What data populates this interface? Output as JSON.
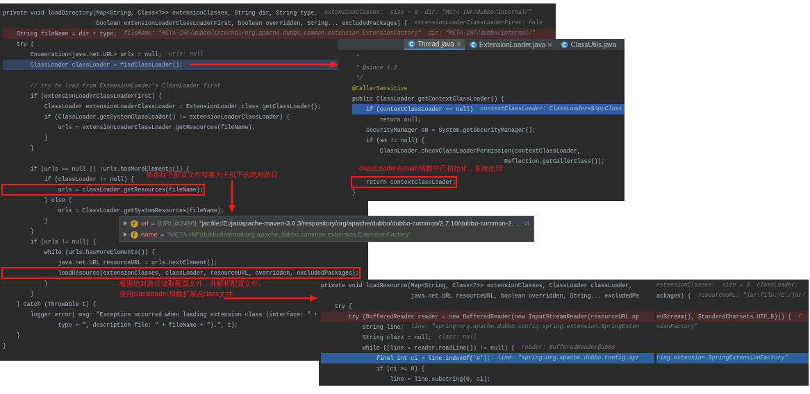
{
  "main_editor": {
    "lines": [
      {
        "code": "private void loadDirectory(Map<String, Class<?>> extensionClasses, String dir, String type,",
        "hint": "extensionClasses:  size = 0  dir: \"META-INF/dubbo/internal/\"",
        "kind": "normal"
      },
      {
        "code": "                           boolean extensionLoaderClassLoaderFirst, boolean overridden, String... excludedPackages) {",
        "hint": "extensionLoaderClassLoaderFirst: fals",
        "kind": "normal"
      },
      {
        "code": "    String fileName = dir + type;",
        "hint": "fileName: \"META-INF/dubbo/internal/org.apache.dubbo.common.extension.ExtensionFactory\"  dir: \"META-INF/dubbo/internal/\"",
        "kind": "error"
      },
      {
        "code": "    try {",
        "kind": "normal"
      },
      {
        "code": "        Enumeration<java.net.URL> urls = null;",
        "hint": "urls: null",
        "kind": "normal"
      },
      {
        "code": "        ClassLoader classLoader = findClassLoader();",
        "kind": "selected"
      },
      {
        "kind": "normal"
      },
      {
        "code": "        // try to load from ExtensionLoader's ClassLoader first",
        "kind": "comment"
      },
      {
        "code": "        if (extensionLoaderClassLoaderFirst) {",
        "kind": "normal"
      },
      {
        "code": "            ClassLoader extensionLoaderClassLoader = ExtensionLoader.class.getClassLoader();",
        "kind": "normal"
      },
      {
        "code": "            if (ClassLoader.getSystemClassLoader() != extensionLoaderClassLoader) {",
        "kind": "normal"
      },
      {
        "code": "                urls = extensionLoaderClassLoader.getResources(fileName);",
        "kind": "normal"
      },
      {
        "code": "            }",
        "kind": "normal"
      },
      {
        "code": "        }",
        "kind": "normal"
      },
      {
        "kind": "normal"
      },
      {
        "code": "        if (urls == null || !urls.hasMoreElements()) {",
        "kind": "normal"
      },
      {
        "code": "            if (classLoader != null) {",
        "kind": "normal"
      },
      {
        "code": "                urls = classLoader.getResources(fileName);",
        "kind": "normal",
        "boxed": true
      },
      {
        "code": "            } else {",
        "kind": "normal"
      },
      {
        "code": "                urls = ClassLoader.getSystemResources(fileName);",
        "kind": "normal"
      },
      {
        "code": "            }",
        "kind": "normal"
      },
      {
        "code": "        }",
        "kind": "normal"
      },
      {
        "code": "        if (urls != null) {",
        "kind": "normal"
      },
      {
        "code": "            while (urls.hasMoreElements()) {",
        "kind": "normal"
      },
      {
        "code": "                java.net.URL resourceURL = urls.nextElement();",
        "kind": "normal"
      },
      {
        "code": "                loadResource(extensionClasses, classLoader, resourceURL, overridden, excludedPackages);",
        "kind": "normal",
        "boxed": true
      },
      {
        "code": "            }",
        "kind": "normal"
      },
      {
        "code": "        }",
        "kind": "normal"
      },
      {
        "code": "    } catch (Throwable t) {",
        "kind": "normal"
      },
      {
        "code": "        logger.error( msg: \"Exception occurred when loading extension class (interface: \" +",
        "kind": "normal"
      },
      {
        "code": "                type + \", description file: \" + fileName + \").\", t);",
        "kind": "normal"
      },
      {
        "code": "    }",
        "kind": "normal"
      },
      {
        "code": "}",
        "kind": "normal"
      }
    ],
    "annotations": [
      "类路径下配置文件转换为主机下的绝对路径",
      "根据绝对路径读取配置文件，并解析配置文件。",
      "使用classloader加载扩展点class文件"
    ]
  },
  "debug_popup": {
    "rows": [
      {
        "name": "url",
        "separator": "=",
        "ref": "{URL@2490}",
        "value": "\"jar:file:/E:/jar/apache-maven-3.6.3/respository/org/apache/dubbo/dubbo-common/2.7.10/dubbo-common-2.",
        "more": "... Vi",
        "kind": "object"
      },
      {
        "name": "name",
        "separator": "=",
        "value": "\"META-INF/dubbo/internal/org.apache.dubbo.common.extension.ExtensionFactory\"",
        "kind": "string"
      }
    ]
  },
  "thread_editor": {
    "tabs": [
      {
        "label": "Thread.java",
        "selected": true,
        "closable": true
      },
      {
        "label": "ExtensionLoader.java",
        "selected": false,
        "closable": true
      },
      {
        "label": "ClassUtils.java",
        "selected": false
      }
    ],
    "lines": [
      {
        "code": " *",
        "kind": "comment"
      },
      {
        "code": " * @since 1.2",
        "kind": "comment"
      },
      {
        "code": " */",
        "kind": "comment"
      },
      {
        "code": "@CallerSensitive",
        "kind": "annotation"
      },
      {
        "code": "public ClassLoader getContextClassLoader() {",
        "kind": "normal"
      },
      {
        "code": "    if (contextClassLoader == null)",
        "hint": "contextClassLoader: ClassLoaders$AppClass",
        "kind": "current"
      },
      {
        "code": "        return null;",
        "kind": "normal"
      },
      {
        "code": "    SecurityManager sm = System.getSecurityManager();",
        "kind": "normal"
      },
      {
        "code": "    if (sm != null) {",
        "kind": "normal"
      },
      {
        "code": "        ClassLoader.checkClassLoaderPermission(contextClassLoader,",
        "kind": "normal"
      },
      {
        "code": "                                            Reflection.getCallerClass());",
        "kind": "normal"
      },
      {
        "kind": "normal"
      },
      {
        "code": "    return contextClassLoader;",
        "kind": "normal",
        "boxed": true
      },
      {
        "code": "}",
        "kind": "normal"
      }
    ],
    "annotations": [
      "classLoader在main函数中已初始化，直接使用"
    ]
  },
  "resource_editor": {
    "lines": [
      {
        "code": "private void loadResource(Map<String, Class<?>> extensionClasses, ClassLoader classLoader,",
        "kind": "normal"
      },
      {
        "code": "                          java.net.URL resourceURL, boolean overridden, String... excludedPa",
        "kind": "normal"
      },
      {
        "code": "    try {",
        "kind": "normal"
      },
      {
        "code": "        try (BufferedReader reader = new BufferedReader(new InputStreamReader(resourceURL.op",
        "kind": "error"
      },
      {
        "code": "            String line;",
        "hint": "line: \"spring=org.apache.dubbo.config.spring.extension.SpringExten",
        "kind": "normal"
      },
      {
        "code": "            String clazz = null;",
        "hint": "clazz: null",
        "kind": "normal"
      },
      {
        "code": "            while ((line = reader.readLine()) != null) {",
        "hint": "reader: BufferedReader@2503",
        "kind": "normal"
      },
      {
        "code": "                final int ci = line.indexOf('#');",
        "hint": "line: \"spring=org.apache.dubbo.config.spr",
        "kind": "current"
      },
      {
        "code": "                if (ci >= 0) {",
        "kind": "normal"
      },
      {
        "code": "                    line = line.substring(0, ci);",
        "kind": "normal"
      }
    ]
  },
  "resource_editor_continued": {
    "lines": [
      {
        "hint": "extensionClasses:  size = 0  classLoader:",
        "kind": "normal"
      },
      {
        "code": "ackages) {",
        "hint": "resourceURL: \"jar:file:/E:/jar/",
        "kind": "normal"
      },
      {
        "kind": "normal"
      },
      {
        "code": "enStream(), StandardCharsets.UTF_8))) {",
        "hint": "r",
        "kind": "error"
      },
      {
        "hint": "sionFactory\"",
        "kind": "normal"
      },
      {
        "kind": "normal"
      },
      {
        "kind": "normal"
      },
      {
        "hint": "ring.extension.SpringExtensionFactory\"",
        "kind": "current"
      },
      {
        "kind": "normal"
      },
      {
        "kind": "normal"
      }
    ]
  }
}
